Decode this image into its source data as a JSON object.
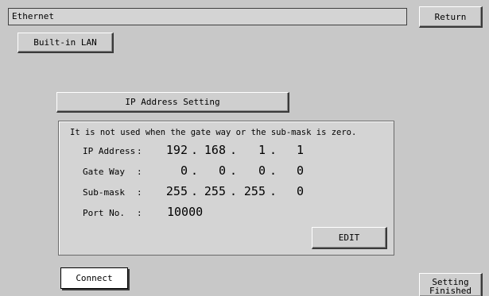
{
  "header": {
    "title": "Ethernet",
    "return_label": "Return"
  },
  "tabs": {
    "builtin_lan": "Built-in LAN"
  },
  "ip_section": {
    "button_label": "IP Address Setting",
    "note": "It is not used when the gate way or the sub-mask is zero.",
    "fields": {
      "ip": {
        "label": "IP Address",
        "colon": ":",
        "octets": [
          "192",
          "168",
          "1",
          "1"
        ]
      },
      "gateway": {
        "label": "Gate Way",
        "colon": ":",
        "octets": [
          "0",
          "0",
          "0",
          "0"
        ]
      },
      "submask": {
        "label": "Sub-mask",
        "colon": ":",
        "octets": [
          "255",
          "255",
          "255",
          "0"
        ]
      },
      "port": {
        "label": "Port No.",
        "colon": ":",
        "value": "10000"
      }
    },
    "dot": ".",
    "edit_label": "EDIT"
  },
  "footer": {
    "connect_label": "Connect",
    "finished_line1": "Setting",
    "finished_line2": "Finished"
  }
}
